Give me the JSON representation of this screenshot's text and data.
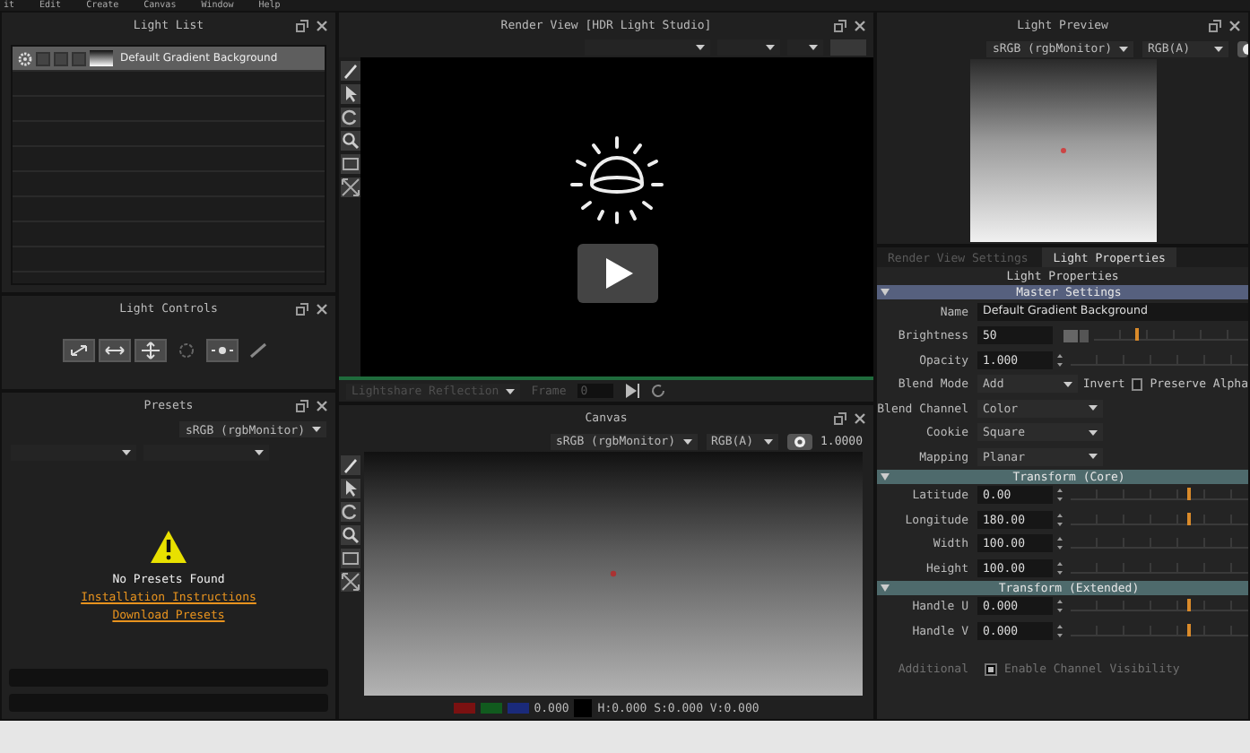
{
  "menu": [
    "it",
    "Edit",
    "Create",
    "Canvas",
    "Window",
    "Help"
  ],
  "light_list": {
    "title": "Light List",
    "lights": [
      {
        "name": "Default Gradient Background",
        "selected": true
      }
    ]
  },
  "light_controls": {
    "title": "Light Controls"
  },
  "presets": {
    "title": "Presets",
    "color_space": "sRGB (rgbMonitor)",
    "message": "No Presets Found",
    "links": [
      "Installation Instructions",
      "Download Presets"
    ]
  },
  "render_view": {
    "title": "Render View [HDR Light Studio]",
    "render_mode": "Lightshare Reflection",
    "frame_label": "Frame",
    "frame": "0"
  },
  "canvas": {
    "title": "Canvas",
    "color_space": "sRGB (rgbMonitor)",
    "channels": "RGB(A)",
    "exposure": "1.0000",
    "rgb_value": "0.000",
    "hsv_value": "H:0.000 S:0.000 V:0.000"
  },
  "light_preview": {
    "title": "Light Preview",
    "color_space": "sRGB (rgbMonitor)",
    "channels": "RGB(A)"
  },
  "properties": {
    "tabs": [
      {
        "label": "Render View Settings",
        "selected": false
      },
      {
        "label": "Light Properties",
        "selected": true
      }
    ],
    "heading": "Light Properties",
    "sections": [
      {
        "title": "Master Settings",
        "color": "#56607e",
        "rows": [
          {
            "kind": "text",
            "label": "Name",
            "value": "Default Gradient Background"
          },
          {
            "kind": "number",
            "label": "Brightness",
            "value": "50",
            "spinner": false,
            "level": 0.27
          },
          {
            "kind": "number",
            "label": "Opacity",
            "value": "1.000",
            "spinner": true
          },
          {
            "kind": "dropdown",
            "label": "Blend Mode",
            "value": "Add",
            "extras": [
              {
                "kind": "label",
                "text": "Invert"
              },
              {
                "kind": "checkbox",
                "text": "Preserve Alpha",
                "checked": false
              }
            ]
          },
          {
            "kind": "dropdown",
            "label": "Blend Channel",
            "value": "Color"
          },
          {
            "kind": "dropdown",
            "label": "Cookie",
            "value": "Square"
          },
          {
            "kind": "dropdown",
            "label": "Mapping",
            "value": "Planar"
          }
        ]
      },
      {
        "title": "Transform (Core)",
        "color": "#4e6a6c",
        "rows": [
          {
            "kind": "number",
            "label": "Latitude",
            "value": "0.00",
            "spinner": true,
            "level": 0.66
          },
          {
            "kind": "number",
            "label": "Longitude",
            "value": "180.00",
            "spinner": true,
            "level": 0.66
          },
          {
            "kind": "number",
            "label": "Width",
            "value": "100.00",
            "spinner": true
          },
          {
            "kind": "number",
            "label": "Height",
            "value": "100.00",
            "spinner": true
          }
        ]
      },
      {
        "title": "Transform (Extended)",
        "color": "#4e6a6c",
        "rows": [
          {
            "kind": "number",
            "label": "Handle U",
            "value": "0.000",
            "spinner": true,
            "level": 0.66
          },
          {
            "kind": "number",
            "label": "Handle V",
            "value": "0.000",
            "spinner": true,
            "level": 0.66
          }
        ]
      }
    ],
    "extra_rows": [
      {
        "kind": "toggle",
        "label": "Additional",
        "text": "Enable Channel Visibility",
        "checked": true,
        "disabled": true
      }
    ]
  }
}
